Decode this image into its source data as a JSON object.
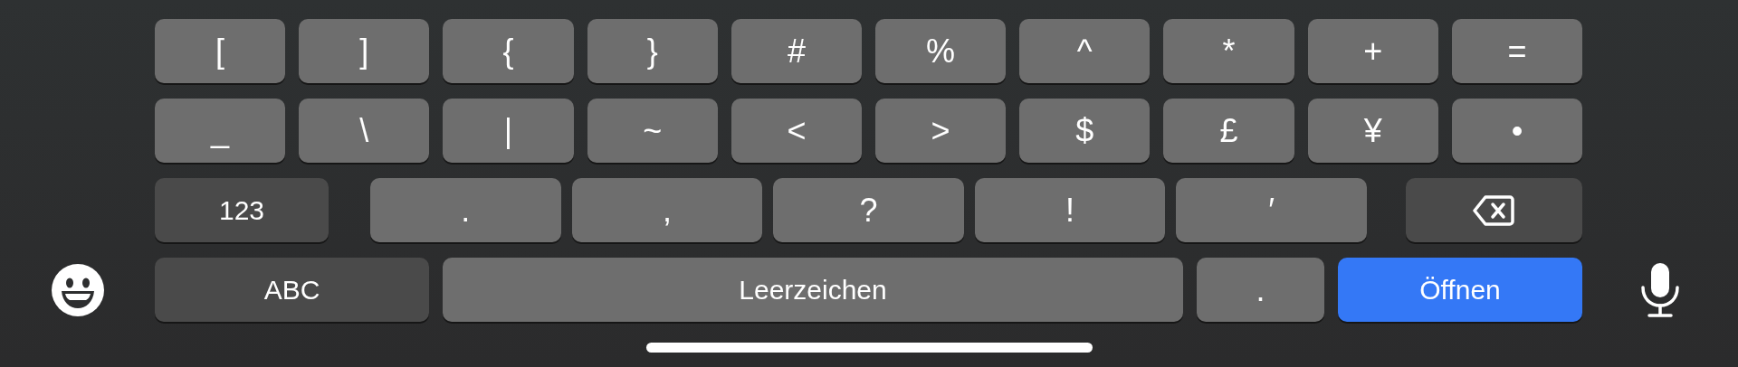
{
  "keyboard": {
    "symbol_rows": [
      [
        "[",
        "]",
        "{",
        "}",
        "#",
        "%",
        "^",
        "*",
        "+",
        "="
      ],
      [
        "_",
        "\\",
        "|",
        "~",
        "<",
        ">",
        "$",
        "£",
        "¥",
        "•"
      ]
    ],
    "punctuation_row": {
      "mode_key": "123",
      "keys": [
        ".",
        ",",
        "?",
        "!",
        "′"
      ]
    },
    "bottom_row": {
      "mode_key": "ABC",
      "space_key": "Leerzeichen",
      "period_key": ".",
      "action_key": "Öffnen"
    }
  }
}
